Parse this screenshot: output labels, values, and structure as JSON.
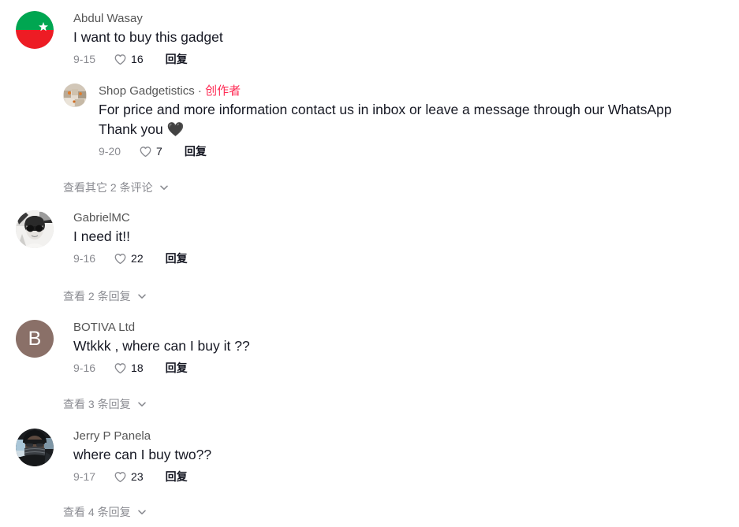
{
  "page": {
    "title": "TikTok comments panel",
    "background": "#ffffff",
    "creator_badge_color": "#FE2C55",
    "username_color": "#555555",
    "text_color": "#161823",
    "muted_color": "#8a8b91"
  },
  "labels": {
    "reply": "回复",
    "creator": "创作者",
    "separator": "·"
  },
  "comments": [
    {
      "id": "c1",
      "username": "Abdul Wasay",
      "is_creator": false,
      "text": "I want to buy this gadget",
      "date": "9-15",
      "likes": "16",
      "avatar": {
        "type": "flag-pti",
        "name": "avatar-abdul-wasay",
        "colors": {
          "top": "#00A651",
          "bottom": "#ED1C24",
          "symbol": "#ffffff"
        }
      },
      "replies": [
        {
          "id": "c1r1",
          "username": "Shop Gadgetistics",
          "is_creator": true,
          "creator_label": "创作者",
          "text_lines": [
            "For price and more information contact us in inbox or leave a message through our WhatsApp",
            "Thank you 🖤"
          ],
          "date": "9-20",
          "likes": "7",
          "avatar": {
            "type": "photo-beige",
            "name": "avatar-shop-gadgetistics",
            "colors": {
              "base": "#cbbfae",
              "accent": "#e8e0d4",
              "dark": "#8e8270"
            }
          }
        }
      ],
      "view_more": {
        "label": "查看其它 2 条评论",
        "count": "2",
        "icon": "chevron-down-icon",
        "name": "view-more-comments-link-1"
      }
    },
    {
      "id": "c2",
      "username": "GabrielMC",
      "is_creator": false,
      "text": "I need it!!",
      "date": "9-16",
      "likes": "22",
      "avatar": {
        "type": "photo-bw-sunglasses",
        "name": "avatar-gabrielmc",
        "colors": {
          "base": "#f0efed",
          "dark": "#2b2b2b",
          "mid": "#8f8f8f"
        }
      },
      "replies": [],
      "view_more": {
        "label": "查看 2 条回复",
        "count": "2",
        "icon": "chevron-down-icon",
        "name": "view-more-replies-link-2"
      }
    },
    {
      "id": "c3",
      "username": "BOTIVA Ltd",
      "is_creator": false,
      "text": "Wtkkk , where can I buy it ??",
      "date": "9-16",
      "likes": "18",
      "avatar": {
        "type": "initial",
        "name": "avatar-botiva-ltd",
        "initial": "B",
        "colors": {
          "base": "#8a7068",
          "text": "#ffffff"
        }
      },
      "replies": [],
      "view_more": {
        "label": "查看 3 条回复",
        "count": "3",
        "icon": "chevron-down-icon",
        "name": "view-more-replies-link-3"
      }
    },
    {
      "id": "c4",
      "username": "Jerry P Panela",
      "is_creator": false,
      "text": "where can I buy two??",
      "date": "9-17",
      "likes": "23",
      "avatar": {
        "type": "photo-dark-mask",
        "name": "avatar-jerry-p-panela",
        "colors": {
          "base": "#1d1f22",
          "sky": "#a9c6d8",
          "mask": "#3a3c40"
        }
      },
      "replies": [],
      "view_more": {
        "label": "查看 4 条回复",
        "count": "4",
        "icon": "chevron-down-icon",
        "name": "view-more-replies-link-4"
      }
    }
  ]
}
